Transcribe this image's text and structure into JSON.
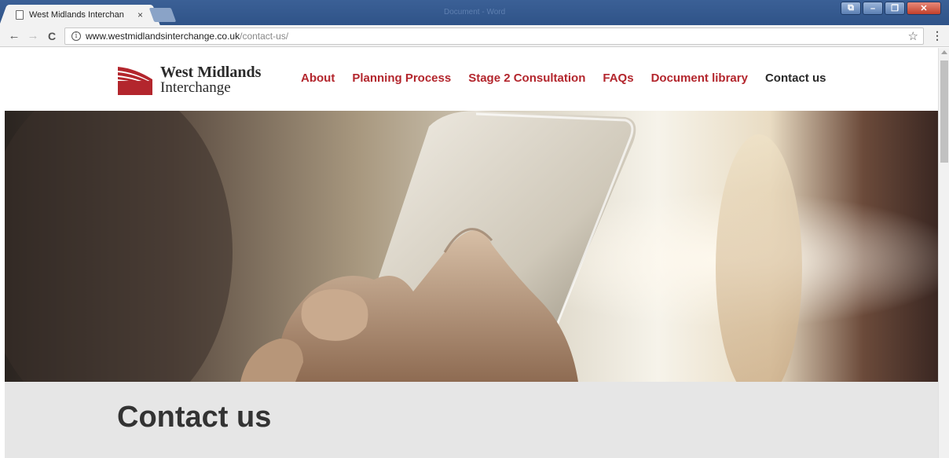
{
  "browser": {
    "tab_title": "West Midlands Interchan",
    "tab_close": "×",
    "window_title": "Document - Word",
    "url_host": "www.westmidlandsinterchange.co.uk",
    "url_path": "/contact-us/",
    "back_glyph": "←",
    "forward_glyph": "→",
    "reload_glyph": "C",
    "star_glyph": "☆",
    "menu_glyph": "⋮",
    "info_glyph": "i",
    "win_min": "–",
    "win_max": "❐",
    "win_close": "✕",
    "win_user": "⧉"
  },
  "site": {
    "logo_line1": "West Midlands",
    "logo_line2": "Interchange",
    "brand_color": "#b3262d",
    "nav": [
      {
        "label": "About"
      },
      {
        "label": "Planning Process"
      },
      {
        "label": "Stage 2 Consultation"
      },
      {
        "label": "FAQs"
      },
      {
        "label": "Document library"
      },
      {
        "label": "Contact us"
      }
    ]
  },
  "page": {
    "title": "Contact us"
  }
}
